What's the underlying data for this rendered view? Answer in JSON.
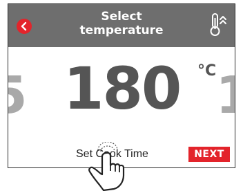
{
  "header": {
    "title_line1": "Select",
    "title_line2": "temperature",
    "back_icon": "back-arrow-icon",
    "right_icon": "thermometer-up-icon",
    "bg_color": "#6e6e6e",
    "accent_color": "#e3242b"
  },
  "temperature": {
    "previous_partial": "5",
    "current": "180",
    "unit": "°C",
    "next_partial": "1"
  },
  "footer": {
    "cook_time_label": "Set Cook Time",
    "next_label": "NEXT"
  },
  "overlay": {
    "icon": "tap-hand-icon"
  }
}
